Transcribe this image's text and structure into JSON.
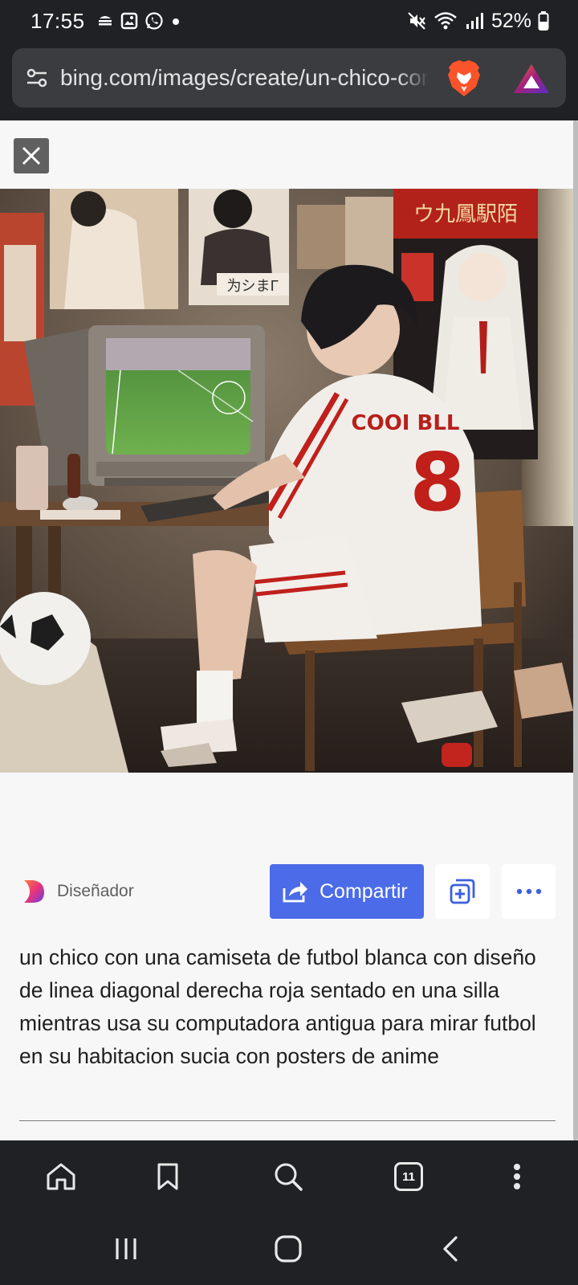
{
  "status_bar": {
    "time": "17:55",
    "battery": "52%",
    "left_icons": [
      "notification-icon",
      "gallery-icon",
      "whatsapp-icon",
      "dot-icon"
    ],
    "right_icons": [
      "mute-icon",
      "wifi-icon",
      "signal-icon",
      "battery-icon"
    ]
  },
  "browser": {
    "url": "bing.com/images/create/un-chico-con-una-camiseta",
    "icons": [
      "tune-icon",
      "brave-shields-icon",
      "brave-rewards-icon"
    ]
  },
  "viewer": {
    "close_icon": "close-icon",
    "image_alt": "un chico con una camiseta de futbol blanca con diseño de linea diagonal derecha roja sentado en una silla mientras usa su computadora antigua para mirar futbol en su habitacion sucia con posters de anime",
    "jersey_text": "COOI BLL",
    "jersey_number": "8",
    "poster_sign": "为シまГ",
    "banner_text": "ウ九鳳駅陌"
  },
  "actions": {
    "designer_label": "Diseñador",
    "share_label": "Compartir",
    "add_icon": "add-to-collection-icon",
    "more_icon": "more-icon"
  },
  "caption": "un chico con una camiseta de futbol blanca con diseño de linea diagonal derecha roja sentado en una silla mientras usa su computadora antigua para mirar futbol en su habitacion sucia con posters de anime",
  "toolbar": {
    "tabs_count": "11",
    "icons": [
      "home-icon",
      "bookmark-icon",
      "search-icon",
      "tabs-icon",
      "menu-icon"
    ]
  },
  "nav": {
    "icons": [
      "recents-icon",
      "home-nav-icon",
      "back-icon"
    ]
  }
}
